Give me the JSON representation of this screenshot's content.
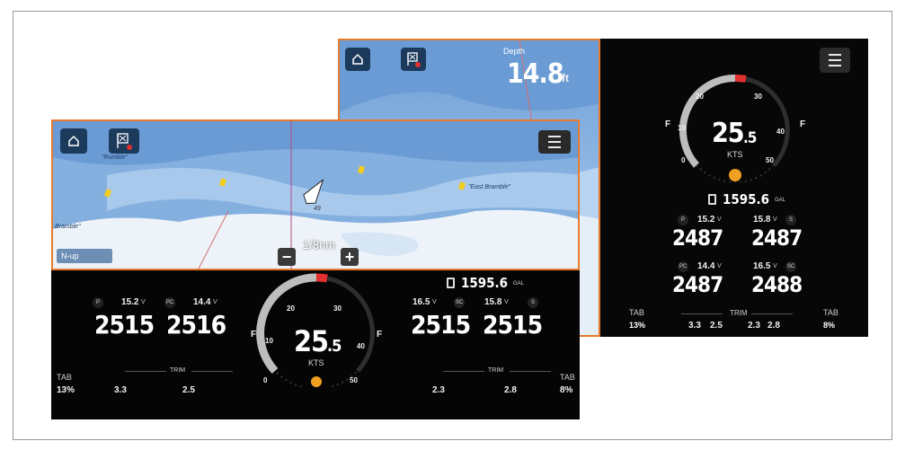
{
  "colors": {
    "accent": "#e67a2e",
    "sea_deep": "#6f9fd6",
    "land": "#e9eef5",
    "gauge_red": "#e03030",
    "button_blue": "#1b3a5c"
  },
  "icons": [
    "home-icon",
    "flag-cross-icon",
    "menu-icon",
    "zoom-in-icon",
    "zoom-out-icon",
    "fuel-icon",
    "boat-icon"
  ],
  "back_screen": {
    "depth_label": "Depth",
    "depth_value": "14.8",
    "depth_unit": "ft",
    "speed_value": "25",
    "speed_decimal": ".5",
    "speed_unit": "KTS",
    "gauge_ticks": [
      "0",
      "10",
      "20",
      "30",
      "40",
      "50"
    ],
    "fuel_value": "1595.6",
    "fuel_unit": "GAL",
    "engines": [
      {
        "tag": "P",
        "volts": "15.2",
        "v": "V",
        "rpm": "2487"
      },
      {
        "tag": "S",
        "volts": "15.8",
        "v": "V",
        "rpm": "2487"
      },
      {
        "tag": "PC",
        "volts": "14.4",
        "v": "V",
        "rpm": "2487"
      },
      {
        "tag": "SC",
        "volts": "16.5",
        "v": "V",
        "rpm": "2488"
      }
    ],
    "tab_left_label": "TAB",
    "tab_left_value": "13%",
    "trim_label": "TRIM",
    "trim_values": [
      "3.3",
      "2.5",
      "2.3",
      "2.8"
    ],
    "tab_right_label": "TAB",
    "tab_right_value": "8%",
    "gauge_f": "F"
  },
  "front_screen": {
    "scale_label": "1/8nm",
    "nup_label": "N-up",
    "chart_names": {
      "rumble": "\"Rumble\"",
      "east_bramble": "\"East Bramble\"",
      "bramble": "Bramble\""
    },
    "depth_soundings": [
      "7",
      "7",
      "5",
      "4",
      "11",
      "11",
      "13",
      "14",
      "12",
      "11",
      "14",
      "49"
    ],
    "fuel_value": "1595.6",
    "fuel_unit": "GAL",
    "speed_value": "25",
    "speed_decimal": ".5",
    "speed_unit": "KTS",
    "gauge_ticks": [
      "0",
      "10",
      "20",
      "30",
      "40",
      "50"
    ],
    "gauge_f": "F",
    "engines": [
      {
        "tag": "P",
        "volts": "15.2",
        "v": "V",
        "rpm": "2515"
      },
      {
        "tag": "PC",
        "volts": "14.4",
        "v": "V",
        "rpm": "2516"
      },
      {
        "tag": "SC",
        "volts": "16.5",
        "v": "V",
        "rpm": "2515"
      },
      {
        "tag": "S",
        "volts": "15.8",
        "v": "V",
        "rpm": "2515"
      }
    ],
    "tab_left_label": "TAB",
    "tab_left_value": "13%",
    "trim_left_label": "TRIM",
    "trim_left": [
      "3.3",
      "2.5"
    ],
    "trim_right_label": "TRIM",
    "trim_right": [
      "2.3",
      "2.8"
    ],
    "tab_right_label": "TAB",
    "tab_right_value": "8%"
  }
}
